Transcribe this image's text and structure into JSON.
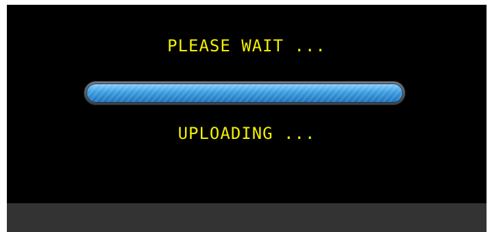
{
  "dialog": {
    "title": "PLEASE WAIT ...",
    "status": "UPLOADING ...",
    "progress": 1.0,
    "text_color": "#f2f000",
    "progress_color": "#3b9de0",
    "background_color": "#000000"
  }
}
